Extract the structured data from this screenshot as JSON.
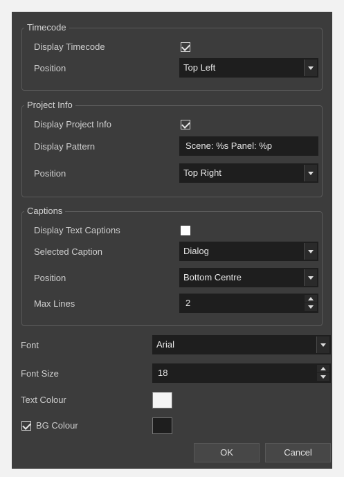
{
  "timecode": {
    "title": "Timecode",
    "display_label": "Display Timecode",
    "display_checked": true,
    "position_label": "Position",
    "position_value": "Top Left"
  },
  "project_info": {
    "title": "Project Info",
    "display_label": "Display Project Info",
    "display_checked": true,
    "pattern_label": "Display Pattern",
    "pattern_value": "Scene: %s Panel: %p",
    "position_label": "Position",
    "position_value": "Top Right"
  },
  "captions": {
    "title": "Captions",
    "display_label": "Display Text Captions",
    "display_checked": false,
    "selected_label": "Selected Caption",
    "selected_value": "Dialog",
    "position_label": "Position",
    "position_value": "Bottom Centre",
    "max_lines_label": "Max Lines",
    "max_lines_value": "2"
  },
  "font": {
    "label": "Font",
    "value": "Arial"
  },
  "font_size": {
    "label": "Font Size",
    "value": "18"
  },
  "text_colour": {
    "label": "Text Colour",
    "color": "#f5f5f5"
  },
  "bg_colour": {
    "label": "BG Colour",
    "checked": true,
    "color": "#1e1e1e"
  },
  "buttons": {
    "ok": "OK",
    "cancel": "Cancel"
  }
}
